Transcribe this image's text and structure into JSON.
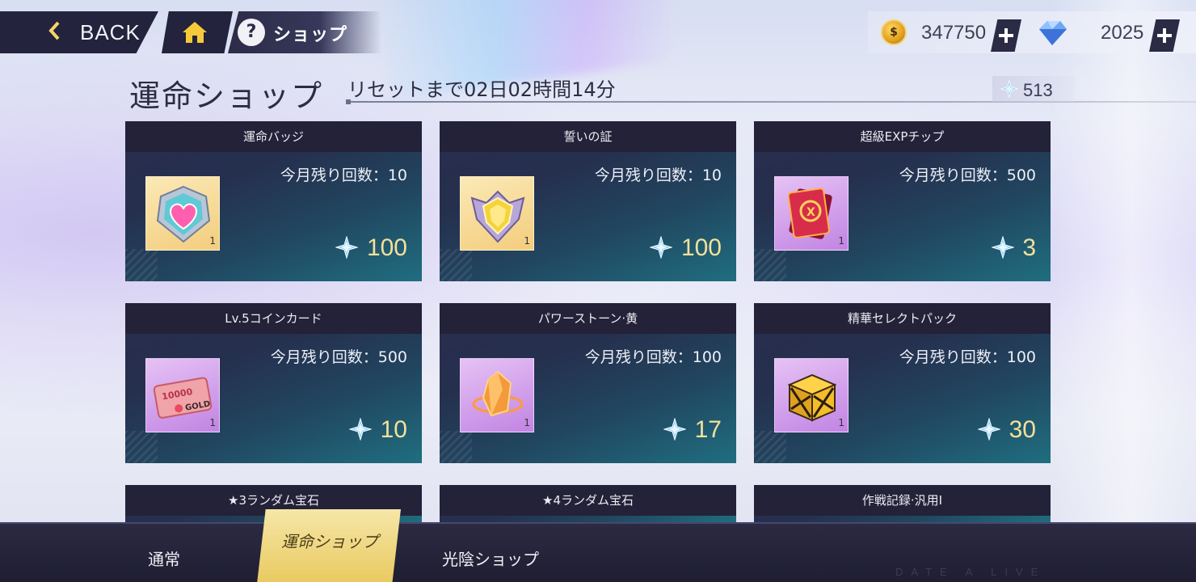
{
  "topbar": {
    "back_label": "BACK",
    "title": "ショップ",
    "currencies": [
      {
        "name": "coin-icon",
        "value": "347750"
      },
      {
        "name": "diamond-icon",
        "value": "2025"
      }
    ]
  },
  "shop": {
    "heading": "運命ショップ",
    "reset_text": "リセットまで02日02時間14分",
    "token_value": "513",
    "cards": [
      {
        "title": "運命バッジ",
        "remain": "今月残り回数：10",
        "price": "100",
        "count": "1",
        "icon": "pink-heart-badge-icon",
        "bg": "gold"
      },
      {
        "title": "誓いの証",
        "remain": "今月残り回数：10",
        "price": "100",
        "count": "1",
        "icon": "yellow-shield-badge-icon",
        "bg": "gold"
      },
      {
        "title": "超級EXPチップ",
        "remain": "今月残り回数：500",
        "price": "3",
        "count": "1",
        "icon": "red-exp-chip-icon",
        "bg": "purple"
      },
      {
        "title": "Lv.5コインカード",
        "remain": "今月残り回数：500",
        "price": "10",
        "count": "1",
        "icon": "gold-coin-card-icon",
        "bg": "purple"
      },
      {
        "title": "パワーストーン·黄",
        "remain": "今月残り回数：100",
        "price": "17",
        "count": "1",
        "icon": "yellow-power-stone-icon",
        "bg": "purple"
      },
      {
        "title": "精華セレクトパック",
        "remain": "今月残り回数：100",
        "price": "30",
        "count": "1",
        "icon": "gold-select-pack-icon",
        "bg": "purple"
      },
      {
        "title": "★3ランダム宝石"
      },
      {
        "title": "★4ランダム宝石"
      },
      {
        "title": "作戦記録·汎用I"
      }
    ]
  },
  "tabs": [
    {
      "label": "通常"
    },
    {
      "label": "運命ショップ",
      "active": true
    },
    {
      "label": "光陰ショップ"
    }
  ],
  "watermark": "DATE A LIVE",
  "colors": {
    "accent_gold": "#f3e09a",
    "tab_active": "#e9c95f",
    "bar_dark": "#24233d"
  }
}
